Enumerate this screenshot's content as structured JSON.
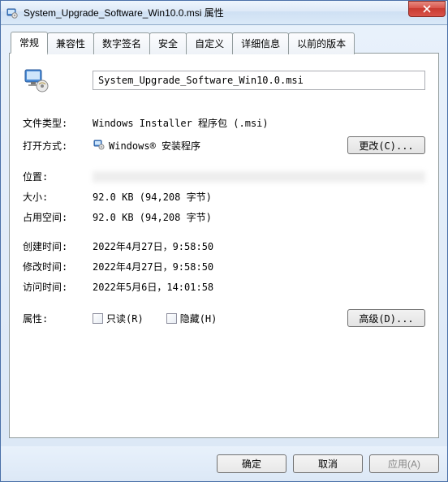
{
  "window": {
    "title": "System_Upgrade_Software_Win10.0.msi 属性"
  },
  "tabs": {
    "general": "常规",
    "compat": "兼容性",
    "digisig": "数字签名",
    "security": "安全",
    "custom": "自定义",
    "details": "详细信息",
    "previous": "以前的版本"
  },
  "general": {
    "filename": "System_Upgrade_Software_Win10.0.msi",
    "filetype_label": "文件类型:",
    "filetype_value": "Windows Installer 程序包 (.msi)",
    "opens_label": "打开方式:",
    "opens_value": "Windows® 安装程序",
    "change_btn": "更改(C)...",
    "location_label": "位置:",
    "location_value": " ",
    "size_label": "大小:",
    "size_value": "92.0 KB (94,208 字节)",
    "ondisk_label": "占用空间:",
    "ondisk_value": "92.0 KB (94,208 字节)",
    "created_label": "创建时间:",
    "created_value": "2022年4月27日，9:58:50",
    "modified_label": "修改时间:",
    "modified_value": "2022年4月27日，9:58:50",
    "accessed_label": "访问时间:",
    "accessed_value": "2022年5月6日，14:01:58",
    "attrs_label": "属性:",
    "readonly_label": "只读(R)",
    "hidden_label": "隐藏(H)",
    "advanced_btn": "高级(D)..."
  },
  "buttons": {
    "ok": "确定",
    "cancel": "取消",
    "apply": "应用(A)"
  }
}
